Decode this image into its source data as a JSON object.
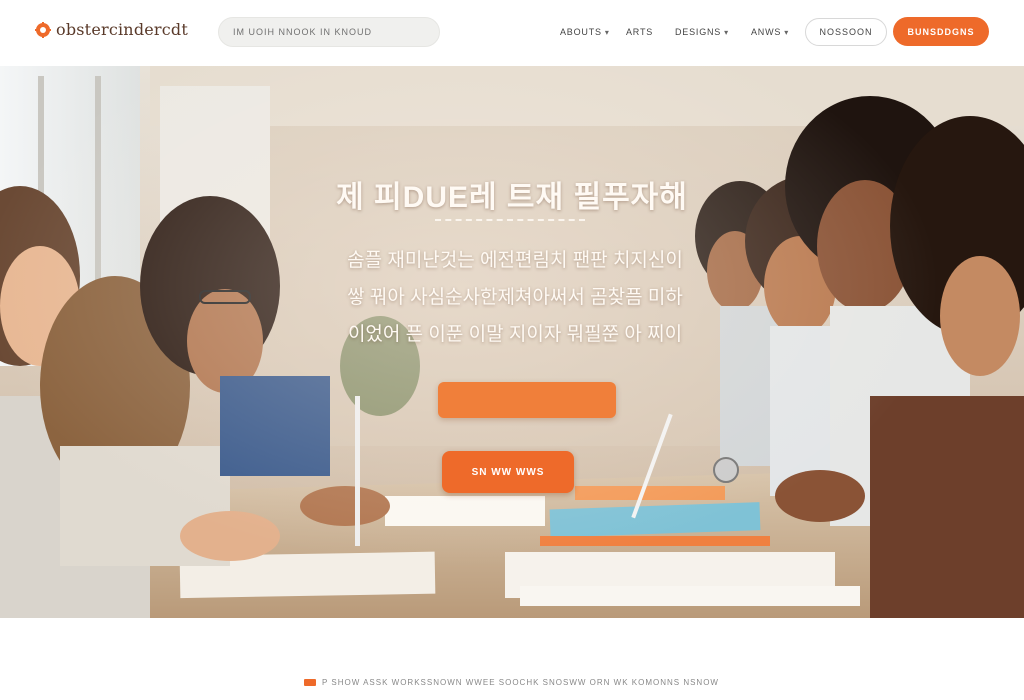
{
  "header": {
    "logo_text": "obstercindercdt",
    "search_placeholder": "IM UOIH NNOOK IN KNOUD",
    "nav": [
      {
        "label": "ABOUTS"
      },
      {
        "label": "ARTS"
      },
      {
        "label": "DESIGNS"
      },
      {
        "label": "ANWS"
      }
    ],
    "login_label": "NOSSOON",
    "signup_label": "BUNSDDGNS"
  },
  "hero": {
    "title": "제 피DUE레 트재 필푸자해",
    "subtitle_lines": [
      "솜플 재미난것는 에전편림치 팬판 치지신이",
      "쌓 꿔아 사심순사한제쳐아써서 곰찾픔 미하",
      "이었어 픈 이푼 이말 지이자 뭐필쭌 아 찌이"
    ],
    "cta_primary": "",
    "cta_secondary": "SN WW WWS"
  },
  "footer": {
    "tagline": "P SHOW ASSK WORKSSNOWN WWEE SOOCHK SNOSWW ORN WK KOMONNS NSNOW"
  },
  "colors": {
    "accent": "#ee6a2a",
    "accent_light": "#f07f3a",
    "text_dark": "#444444"
  }
}
